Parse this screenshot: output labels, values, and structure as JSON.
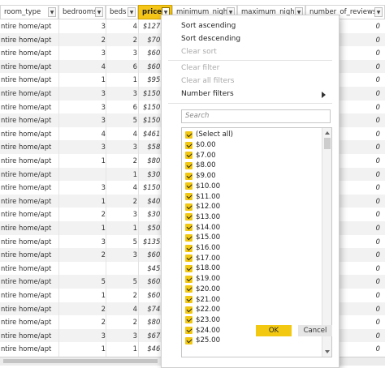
{
  "columns": {
    "room_type": "room_type",
    "bedrooms": "bedrooms",
    "beds": "beds",
    "price": "price",
    "minimum_nights": "minimum_nights",
    "maximum_nights": "maximum_nights",
    "number_of_reviews": "number_of_reviews"
  },
  "rows": [
    {
      "room_type": "ntire home/apt",
      "bedrooms": "3",
      "beds": "4",
      "price": "$127.",
      "reviews": "0"
    },
    {
      "room_type": "ntire home/apt",
      "bedrooms": "2",
      "beds": "2",
      "price": "$70.",
      "reviews": "0"
    },
    {
      "room_type": "ntire home/apt",
      "bedrooms": "3",
      "beds": "3",
      "price": "$60.",
      "reviews": "0"
    },
    {
      "room_type": "ntire home/apt",
      "bedrooms": "4",
      "beds": "6",
      "price": "$60.",
      "reviews": "0"
    },
    {
      "room_type": "ntire home/apt",
      "bedrooms": "1",
      "beds": "1",
      "price": "$95.",
      "reviews": "0"
    },
    {
      "room_type": "ntire home/apt",
      "bedrooms": "3",
      "beds": "3",
      "price": "$150.",
      "reviews": "0"
    },
    {
      "room_type": "ntire home/apt",
      "bedrooms": "3",
      "beds": "6",
      "price": "$150.",
      "reviews": "0"
    },
    {
      "room_type": "ntire home/apt",
      "bedrooms": "3",
      "beds": "5",
      "price": "$150.",
      "reviews": "0"
    },
    {
      "room_type": "ntire home/apt",
      "bedrooms": "4",
      "beds": "4",
      "price": "$461.",
      "reviews": "0"
    },
    {
      "room_type": "ntire home/apt",
      "bedrooms": "3",
      "beds": "3",
      "price": "$58.",
      "reviews": "0"
    },
    {
      "room_type": "ntire home/apt",
      "bedrooms": "1",
      "beds": "2",
      "price": "$80.",
      "reviews": "0"
    },
    {
      "room_type": "ntire home/apt",
      "bedrooms": "",
      "beds": "1",
      "price": "$30.",
      "reviews": "0"
    },
    {
      "room_type": "ntire home/apt",
      "bedrooms": "3",
      "beds": "4",
      "price": "$150.",
      "reviews": "0"
    },
    {
      "room_type": "ntire home/apt",
      "bedrooms": "1",
      "beds": "2",
      "price": "$40.",
      "reviews": "0"
    },
    {
      "room_type": "ntire home/apt",
      "bedrooms": "2",
      "beds": "3",
      "price": "$30.",
      "reviews": "0"
    },
    {
      "room_type": "ntire home/apt",
      "bedrooms": "1",
      "beds": "1",
      "price": "$50.",
      "reviews": "0"
    },
    {
      "room_type": "ntire home/apt",
      "bedrooms": "3",
      "beds": "5",
      "price": "$135.",
      "reviews": "0"
    },
    {
      "room_type": "ntire home/apt",
      "bedrooms": "2",
      "beds": "3",
      "price": "$60.",
      "reviews": "0"
    },
    {
      "room_type": "ntire home/apt",
      "bedrooms": "",
      "beds": "",
      "price": "$45.",
      "reviews": "0"
    },
    {
      "room_type": "ntire home/apt",
      "bedrooms": "5",
      "beds": "5",
      "price": "$60.",
      "reviews": "0"
    },
    {
      "room_type": "ntire home/apt",
      "bedrooms": "1",
      "beds": "2",
      "price": "$60.",
      "reviews": "0"
    },
    {
      "room_type": "ntire home/apt",
      "bedrooms": "2",
      "beds": "4",
      "price": "$74.",
      "reviews": "0"
    },
    {
      "room_type": "ntire home/apt",
      "bedrooms": "2",
      "beds": "2",
      "price": "$80.",
      "reviews": "0"
    },
    {
      "room_type": "ntire home/apt",
      "bedrooms": "3",
      "beds": "3",
      "price": "$67.",
      "reviews": "0"
    },
    {
      "room_type": "ntire home/apt",
      "bedrooms": "1",
      "beds": "1",
      "price": "$46.",
      "reviews": "0"
    }
  ],
  "menu": {
    "sort_ascending": "Sort ascending",
    "sort_descending": "Sort descending",
    "clear_sort": "Clear sort",
    "clear_filter": "Clear filter",
    "clear_all_filters": "Clear all filters",
    "number_filters": "Number filters",
    "search_placeholder": "Search",
    "values": [
      "(Select all)",
      "$0.00",
      "$7.00",
      "$8.00",
      "$9.00",
      "$10.00",
      "$11.00",
      "$12.00",
      "$13.00",
      "$14.00",
      "$15.00",
      "$16.00",
      "$17.00",
      "$18.00",
      "$19.00",
      "$20.00",
      "$21.00",
      "$22.00",
      "$23.00",
      "$24.00",
      "$25.00"
    ],
    "ok": "OK",
    "cancel": "Cancel"
  },
  "colors": {
    "accent": "#f2c811",
    "row_alt": "#f2f2f2"
  }
}
